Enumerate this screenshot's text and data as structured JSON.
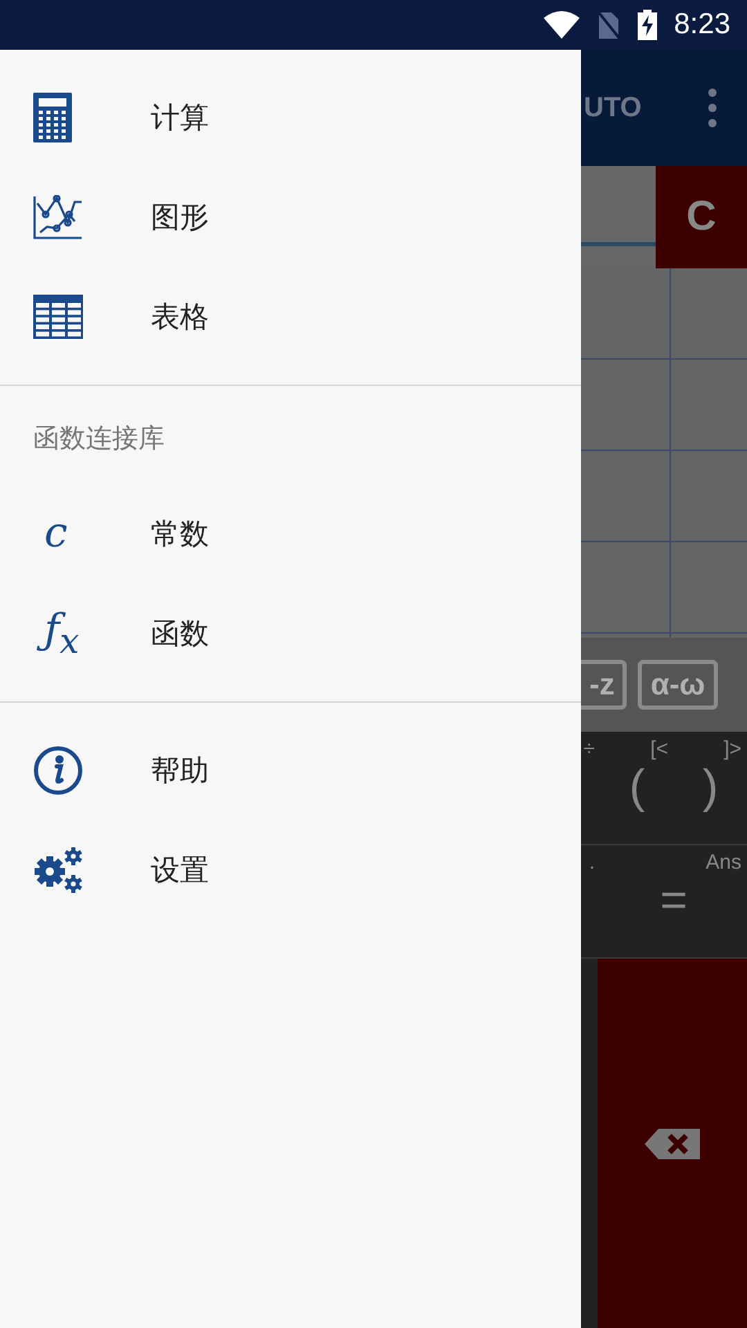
{
  "status_bar": {
    "time": "8:23"
  },
  "drawer": {
    "sections": [
      {
        "items": [
          {
            "label": "计算",
            "kind": "calculator"
          },
          {
            "label": "图形",
            "kind": "graph"
          },
          {
            "label": "表格",
            "kind": "table"
          }
        ]
      },
      {
        "header": "函数连接库",
        "items": [
          {
            "label": "常数",
            "kind": "glyph",
            "glyph": "c"
          },
          {
            "label": "函数",
            "kind": "glyph",
            "glyph": "ƒ$_{x}$"
          }
        ]
      },
      {
        "items": [
          {
            "label": "帮助",
            "kind": "info"
          },
          {
            "label": "设置",
            "kind": "gears"
          }
        ]
      }
    ]
  },
  "background_app": {
    "toolbar_text": "UTO",
    "clear_key": "C",
    "letter_keys": [
      "-z",
      "α-ω"
    ],
    "keypad": [
      [
        {
          "top": "÷"
        },
        {
          "top": "[<",
          "main": "("
        },
        {
          "top": "]>",
          "main": ")"
        }
      ],
      [
        {
          "top": "."
        },
        {
          "top": "Ans",
          "main": "="
        }
      ]
    ]
  }
}
